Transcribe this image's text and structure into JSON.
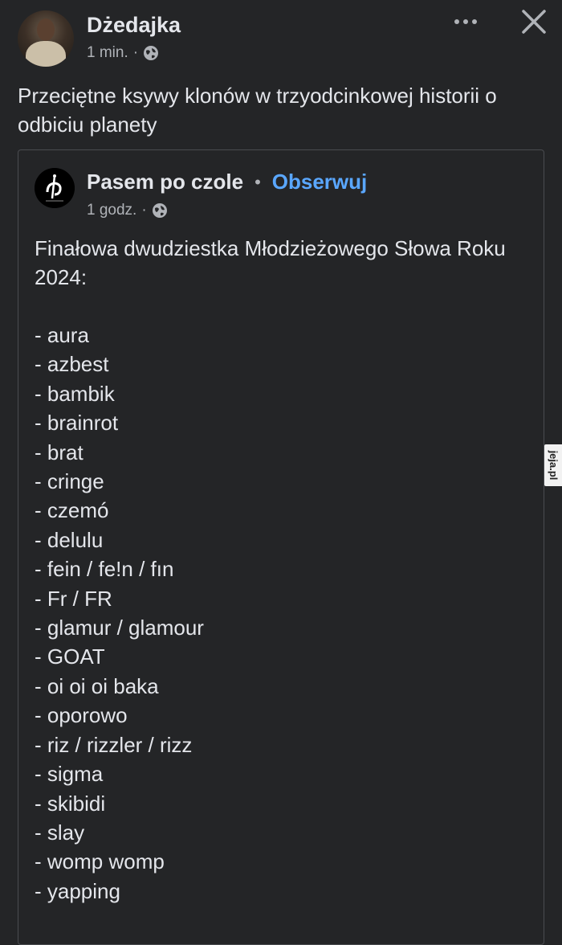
{
  "post": {
    "author": "Dżedajka",
    "time": "1 min.",
    "separator": "·",
    "text": "Przeciętne ksywy klonów w trzyodcinkowej historii o odbiciu planety"
  },
  "shared": {
    "author": "Pasem po czole",
    "separator": "•",
    "follow_label": "Obserwuj",
    "time": "1 godz.",
    "meta_separator": "·",
    "intro": "Finałowa dwudziestka Młodzieżowego Słowa Roku 2024:",
    "words": [
      "- aura",
      "- azbest",
      "- bambik",
      "- brainrot",
      "- brat",
      "- cringe",
      "- czemó",
      "- delulu",
      "- fein / fe!n / fın",
      "- Fr / FR",
      "- glamur / glamour",
      "- GOAT",
      "- oi oi oi baka",
      "- oporowo",
      "- riz / rizzler / rizz",
      "- sigma",
      "- skibidi",
      "- slay",
      "- womp womp",
      "- yapping"
    ]
  },
  "watermark": "jeja.pl",
  "icons": {
    "more": "more-options-icon",
    "close": "close-icon",
    "privacy": "globe-icon"
  },
  "colors": {
    "background": "#242527",
    "text": "#e4e6eb",
    "muted": "#b0b3b8",
    "link": "#5aa7ff"
  }
}
